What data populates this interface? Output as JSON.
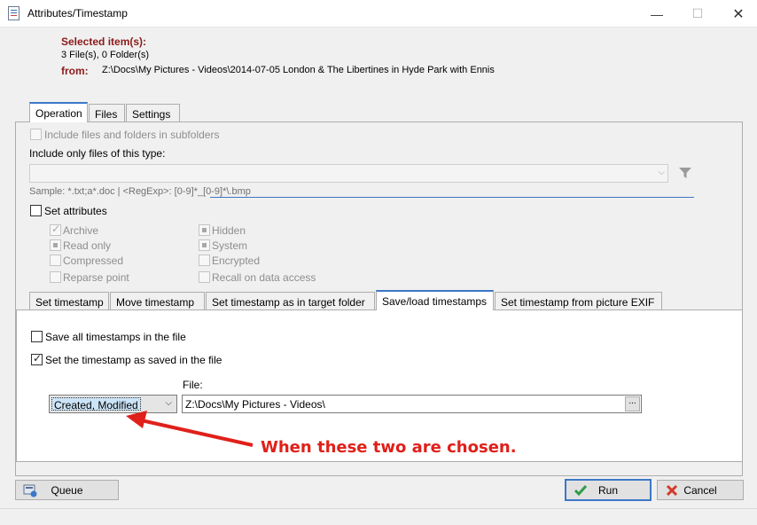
{
  "window": {
    "title": "Attributes/Timestamp",
    "controls": {
      "minimize": "—",
      "maximize": "☐",
      "close": "✕"
    }
  },
  "header": {
    "selected_label": "Selected item(s):",
    "count": "3 File(s), 0 Folder(s)",
    "from_label": "from:",
    "from_path": "Z:\\Docs\\My Pictures - Videos\\2014-07-05 London & The Libertines in Hyde Park with Ennis"
  },
  "main_tabs": [
    "Operation",
    "Files",
    "Settings"
  ],
  "operation": {
    "include_subfolders": "Include files and folders in subfolders",
    "include_only_label": "Include only files of this type:",
    "sample": "Sample: *.txt;a*.doc | <RegExp>: [0-9]*_[0-9]*\\.bmp",
    "set_attributes": "Set attributes",
    "attributes": {
      "archive": "Archive",
      "hidden": "Hidden",
      "read_only": "Read only",
      "system": "System",
      "compressed": "Compressed",
      "encrypted": "Encrypted",
      "reparse_point": "Reparse point",
      "recall": "Recall on data access"
    }
  },
  "timestamp_tabs": [
    "Set timestamp",
    "Move timestamp",
    "Set timestamp as in target folder",
    "Save/load timestamps",
    "Set timestamp from picture EXIF"
  ],
  "save_load": {
    "save_all": "Save all timestamps in the file",
    "set_as_saved": "Set the timestamp as saved in the file",
    "file_label": "File:",
    "mode_value": "Created, Modified",
    "file_value": "Z:\\Docs\\My Pictures - Videos\\",
    "browse": "..."
  },
  "annotation": "When these two are chosen.",
  "buttons": {
    "queue": "Queue",
    "run": "Run",
    "cancel": "Cancel"
  },
  "colors": {
    "accent": "#3c78c8",
    "header_red": "#8b1a1a",
    "annotation_red": "#e0201a"
  },
  "icons": {
    "filter": "funnel-icon",
    "run": "check-icon",
    "cancel": "cross-icon",
    "queue": "queue-icon"
  }
}
